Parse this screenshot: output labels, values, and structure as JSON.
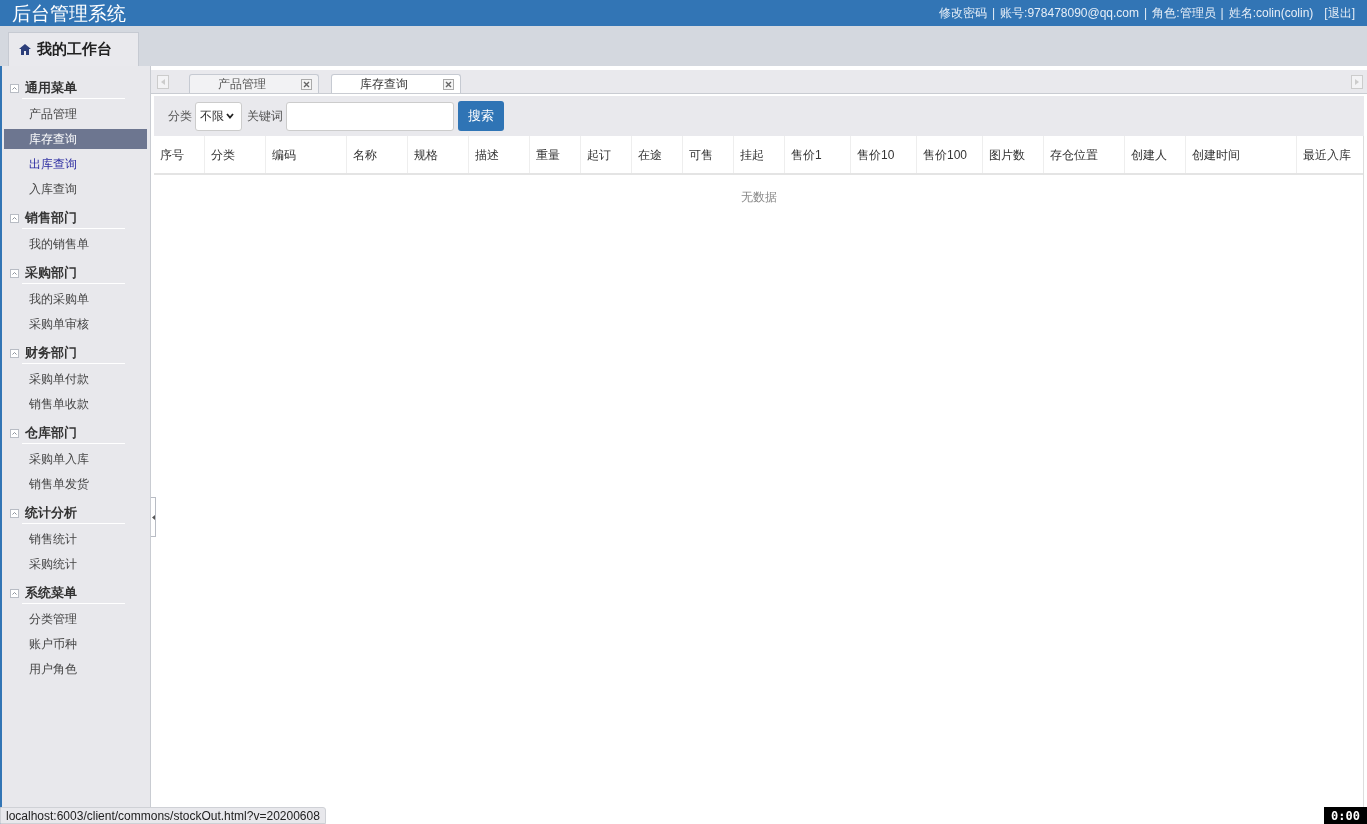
{
  "header": {
    "title": "后台管理系统",
    "links": [
      {
        "kind": "link",
        "text": "修改密码"
      },
      {
        "kind": "sep",
        "text": "|"
      },
      {
        "kind": "text",
        "text": "账号:978478090@qq.com"
      },
      {
        "kind": "sep",
        "text": "|"
      },
      {
        "kind": "text",
        "text": "角色:管理员"
      },
      {
        "kind": "sep",
        "text": "|"
      },
      {
        "kind": "text",
        "text": "姓名:colin(colin)"
      },
      {
        "kind": "link",
        "text": "[退出]"
      }
    ]
  },
  "workbench_tab": {
    "label": "我的工作台"
  },
  "sidebar": {
    "groups": [
      {
        "title": "通用菜单",
        "expanded": true,
        "items": [
          {
            "label": "产品管理",
            "selected": false,
            "hovered": false
          },
          {
            "label": "库存查询",
            "selected": true,
            "hovered": false
          },
          {
            "label": "出库查询",
            "selected": false,
            "hovered": true
          },
          {
            "label": "入库查询",
            "selected": false,
            "hovered": false
          }
        ]
      },
      {
        "title": "销售部门",
        "expanded": true,
        "items": [
          {
            "label": "我的销售单",
            "selected": false,
            "hovered": false
          }
        ]
      },
      {
        "title": "采购部门",
        "expanded": true,
        "items": [
          {
            "label": "我的采购单",
            "selected": false,
            "hovered": false
          },
          {
            "label": "采购单审核",
            "selected": false,
            "hovered": false
          }
        ]
      },
      {
        "title": "财务部门",
        "expanded": true,
        "items": [
          {
            "label": "采购单付款",
            "selected": false,
            "hovered": false
          },
          {
            "label": "销售单收款",
            "selected": false,
            "hovered": false
          }
        ]
      },
      {
        "title": "仓库部门",
        "expanded": true,
        "items": [
          {
            "label": "采购单入库",
            "selected": false,
            "hovered": false
          },
          {
            "label": "销售单发货",
            "selected": false,
            "hovered": false
          }
        ]
      },
      {
        "title": "统计分析",
        "expanded": true,
        "items": [
          {
            "label": "销售统计",
            "selected": false,
            "hovered": false
          },
          {
            "label": "采购统计",
            "selected": false,
            "hovered": false
          }
        ]
      },
      {
        "title": "系统菜单",
        "expanded": true,
        "items": [
          {
            "label": "分类管理",
            "selected": false,
            "hovered": false
          },
          {
            "label": "账户币种",
            "selected": false,
            "hovered": false
          },
          {
            "label": "用户角色",
            "selected": false,
            "hovered": false
          }
        ]
      }
    ]
  },
  "tabs": [
    {
      "label": "产品管理",
      "selected": false
    },
    {
      "label": "库存查询",
      "selected": true
    }
  ],
  "toolbar": {
    "category_label": "分类",
    "category_value": "不限",
    "keyword_label": "关键词",
    "search_button": "搜索"
  },
  "table": {
    "columns": [
      "序号",
      "分类",
      "编码",
      "名称",
      "规格",
      "描述",
      "重量",
      "起订",
      "在途",
      "可售",
      "挂起",
      "售价1",
      "售价10",
      "售价100",
      "图片数",
      "存仓位置",
      "创建人",
      "创建时间",
      "最近入库"
    ],
    "empty_text": "无数据"
  },
  "status_bar": {
    "url": "localhost:6003/client/commons/stockOut.html?v=20200608"
  },
  "timer": "0:00"
}
